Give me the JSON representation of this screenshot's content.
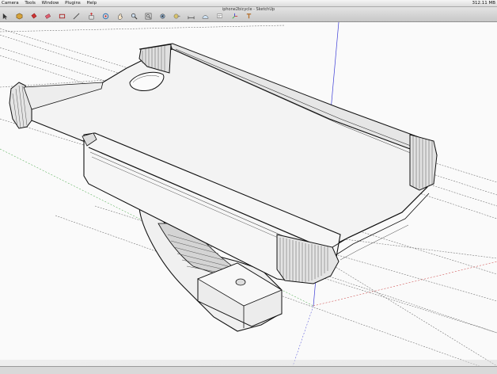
{
  "menubar": {
    "items": [
      "Camera",
      "Tools",
      "Window",
      "Plugins",
      "Help"
    ],
    "status": {
      "memory": "312.11 MB"
    }
  },
  "window": {
    "title": "iphone2bicycle - SketchUp"
  },
  "toolbar": {
    "tools": [
      {
        "name": "select-icon"
      },
      {
        "name": "component-icon"
      },
      {
        "name": "paint-bucket-icon"
      },
      {
        "name": "eraser-icon"
      },
      {
        "name": "rectangle-icon"
      },
      {
        "name": "line-icon"
      },
      {
        "name": "push-pull-icon"
      },
      {
        "name": "orbit-icon"
      },
      {
        "name": "pan-icon"
      },
      {
        "name": "zoom-icon"
      },
      {
        "name": "zoom-extents-icon"
      },
      {
        "name": "previous-view-icon"
      },
      {
        "name": "tape-measure-icon"
      },
      {
        "name": "dimension-icon"
      },
      {
        "name": "protractor-icon"
      },
      {
        "name": "text-icon"
      },
      {
        "name": "axes-icon"
      },
      {
        "name": "3d-text-icon"
      }
    ]
  },
  "viewport": {
    "model": "iphone case bicycle mount",
    "background": "#fafafa",
    "axis_colors": {
      "blue": "#3b3bd6",
      "green": "#2e9e2e",
      "red": "#c83232"
    }
  }
}
